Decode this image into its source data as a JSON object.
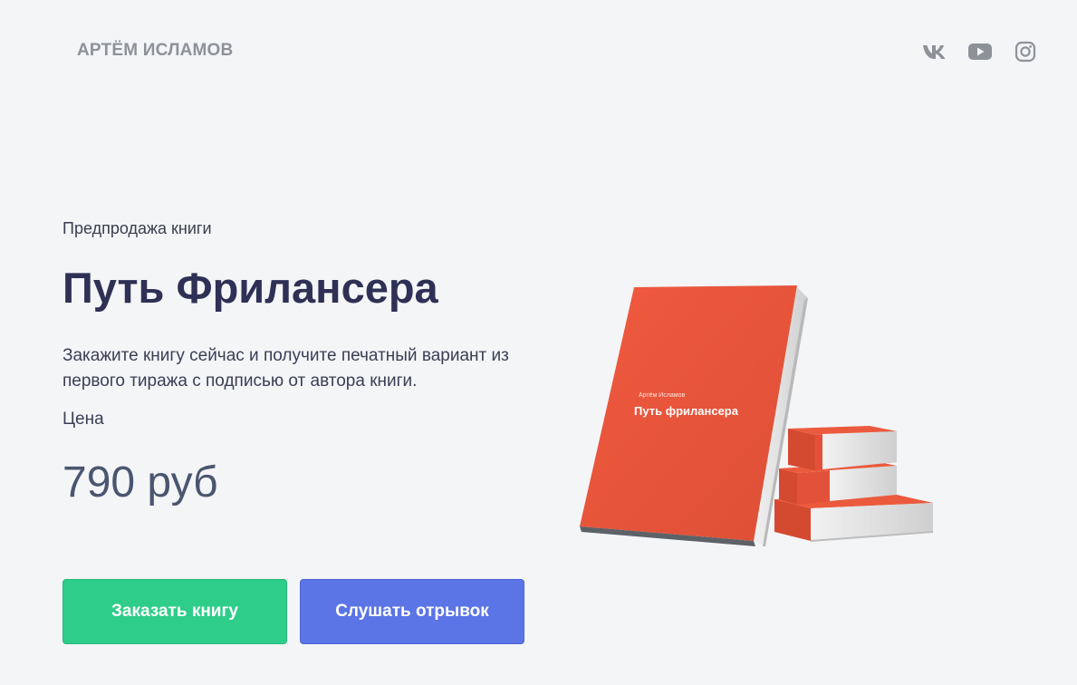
{
  "header": {
    "logo": "АРТЁМ ИСЛАМОВ",
    "socials": [
      {
        "icon": "vk-icon"
      },
      {
        "icon": "youtube-icon"
      },
      {
        "icon": "instagram-icon"
      }
    ]
  },
  "hero": {
    "eyebrow": "Предпродажа книги",
    "title": "Путь Фрилансера",
    "description": "Закажите книгу сейчас и получите печатный вариант из первого тиража с подписью от автора книги.",
    "price_label": "Цена",
    "price": "790 руб",
    "buttons": {
      "order": "Заказать книгу",
      "listen": "Слушать отрывок"
    }
  },
  "book": {
    "author": "Артём Исламов",
    "title": "Путь фрилансера"
  },
  "colors": {
    "background": "#f4f5f7",
    "order_button": "#2ecd89",
    "listen_button": "#5b74e6",
    "title": "#2e3155",
    "book_cover": "#e95a3e"
  }
}
